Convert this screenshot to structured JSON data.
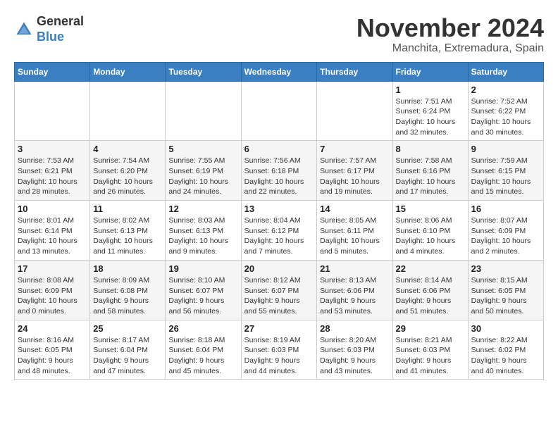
{
  "header": {
    "logo_line1": "General",
    "logo_line2": "Blue",
    "month_year": "November 2024",
    "location": "Manchita, Extremadura, Spain"
  },
  "weekdays": [
    "Sunday",
    "Monday",
    "Tuesday",
    "Wednesday",
    "Thursday",
    "Friday",
    "Saturday"
  ],
  "weeks": [
    [
      {
        "day": "",
        "info": ""
      },
      {
        "day": "",
        "info": ""
      },
      {
        "day": "",
        "info": ""
      },
      {
        "day": "",
        "info": ""
      },
      {
        "day": "",
        "info": ""
      },
      {
        "day": "1",
        "info": "Sunrise: 7:51 AM\nSunset: 6:24 PM\nDaylight: 10 hours and 32 minutes."
      },
      {
        "day": "2",
        "info": "Sunrise: 7:52 AM\nSunset: 6:22 PM\nDaylight: 10 hours and 30 minutes."
      }
    ],
    [
      {
        "day": "3",
        "info": "Sunrise: 7:53 AM\nSunset: 6:21 PM\nDaylight: 10 hours and 28 minutes."
      },
      {
        "day": "4",
        "info": "Sunrise: 7:54 AM\nSunset: 6:20 PM\nDaylight: 10 hours and 26 minutes."
      },
      {
        "day": "5",
        "info": "Sunrise: 7:55 AM\nSunset: 6:19 PM\nDaylight: 10 hours and 24 minutes."
      },
      {
        "day": "6",
        "info": "Sunrise: 7:56 AM\nSunset: 6:18 PM\nDaylight: 10 hours and 22 minutes."
      },
      {
        "day": "7",
        "info": "Sunrise: 7:57 AM\nSunset: 6:17 PM\nDaylight: 10 hours and 19 minutes."
      },
      {
        "day": "8",
        "info": "Sunrise: 7:58 AM\nSunset: 6:16 PM\nDaylight: 10 hours and 17 minutes."
      },
      {
        "day": "9",
        "info": "Sunrise: 7:59 AM\nSunset: 6:15 PM\nDaylight: 10 hours and 15 minutes."
      }
    ],
    [
      {
        "day": "10",
        "info": "Sunrise: 8:01 AM\nSunset: 6:14 PM\nDaylight: 10 hours and 13 minutes."
      },
      {
        "day": "11",
        "info": "Sunrise: 8:02 AM\nSunset: 6:13 PM\nDaylight: 10 hours and 11 minutes."
      },
      {
        "day": "12",
        "info": "Sunrise: 8:03 AM\nSunset: 6:13 PM\nDaylight: 10 hours and 9 minutes."
      },
      {
        "day": "13",
        "info": "Sunrise: 8:04 AM\nSunset: 6:12 PM\nDaylight: 10 hours and 7 minutes."
      },
      {
        "day": "14",
        "info": "Sunrise: 8:05 AM\nSunset: 6:11 PM\nDaylight: 10 hours and 5 minutes."
      },
      {
        "day": "15",
        "info": "Sunrise: 8:06 AM\nSunset: 6:10 PM\nDaylight: 10 hours and 4 minutes."
      },
      {
        "day": "16",
        "info": "Sunrise: 8:07 AM\nSunset: 6:09 PM\nDaylight: 10 hours and 2 minutes."
      }
    ],
    [
      {
        "day": "17",
        "info": "Sunrise: 8:08 AM\nSunset: 6:09 PM\nDaylight: 10 hours and 0 minutes."
      },
      {
        "day": "18",
        "info": "Sunrise: 8:09 AM\nSunset: 6:08 PM\nDaylight: 9 hours and 58 minutes."
      },
      {
        "day": "19",
        "info": "Sunrise: 8:10 AM\nSunset: 6:07 PM\nDaylight: 9 hours and 56 minutes."
      },
      {
        "day": "20",
        "info": "Sunrise: 8:12 AM\nSunset: 6:07 PM\nDaylight: 9 hours and 55 minutes."
      },
      {
        "day": "21",
        "info": "Sunrise: 8:13 AM\nSunset: 6:06 PM\nDaylight: 9 hours and 53 minutes."
      },
      {
        "day": "22",
        "info": "Sunrise: 8:14 AM\nSunset: 6:06 PM\nDaylight: 9 hours and 51 minutes."
      },
      {
        "day": "23",
        "info": "Sunrise: 8:15 AM\nSunset: 6:05 PM\nDaylight: 9 hours and 50 minutes."
      }
    ],
    [
      {
        "day": "24",
        "info": "Sunrise: 8:16 AM\nSunset: 6:05 PM\nDaylight: 9 hours and 48 minutes."
      },
      {
        "day": "25",
        "info": "Sunrise: 8:17 AM\nSunset: 6:04 PM\nDaylight: 9 hours and 47 minutes."
      },
      {
        "day": "26",
        "info": "Sunrise: 8:18 AM\nSunset: 6:04 PM\nDaylight: 9 hours and 45 minutes."
      },
      {
        "day": "27",
        "info": "Sunrise: 8:19 AM\nSunset: 6:03 PM\nDaylight: 9 hours and 44 minutes."
      },
      {
        "day": "28",
        "info": "Sunrise: 8:20 AM\nSunset: 6:03 PM\nDaylight: 9 hours and 43 minutes."
      },
      {
        "day": "29",
        "info": "Sunrise: 8:21 AM\nSunset: 6:03 PM\nDaylight: 9 hours and 41 minutes."
      },
      {
        "day": "30",
        "info": "Sunrise: 8:22 AM\nSunset: 6:02 PM\nDaylight: 9 hours and 40 minutes."
      }
    ]
  ]
}
